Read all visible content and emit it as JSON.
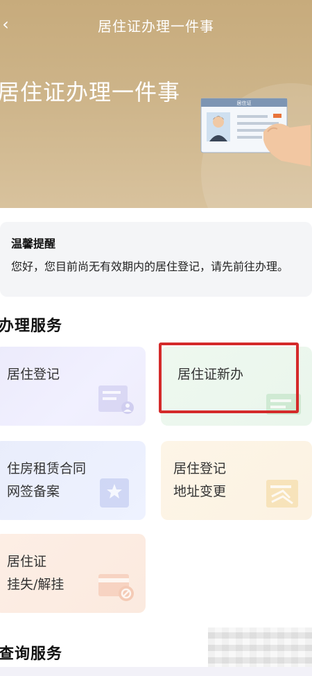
{
  "nav": {
    "title": "居住证办理一件事",
    "back_icon": "chevron-left-icon"
  },
  "hero": {
    "title": "居住证办理一件事",
    "card_label": "居住证",
    "colors": {
      "banner": "#c7ab7c"
    }
  },
  "reminder": {
    "title": "温馨提醒",
    "text": "您好，您目前尚无有效期内的居住登记，请先前往办理。"
  },
  "sections": {
    "handle": "办理服务",
    "query": "查询服务"
  },
  "tiles": [
    {
      "line1": "居住登记",
      "line2": "",
      "icon": "form-person-icon"
    },
    {
      "line1": "居住证新办",
      "line2": "",
      "icon": "card-icon",
      "highlighted": true
    },
    {
      "line1": "住房租赁合同",
      "line2": "网签备案",
      "icon": "document-star-icon"
    },
    {
      "line1": "居住登记",
      "line2": "地址变更",
      "icon": "edit-document-icon"
    },
    {
      "line1": "居住证",
      "line2": "挂失/解挂",
      "icon": "card-blocked-icon"
    }
  ],
  "colors": {
    "highlight": "#d42a2a"
  }
}
